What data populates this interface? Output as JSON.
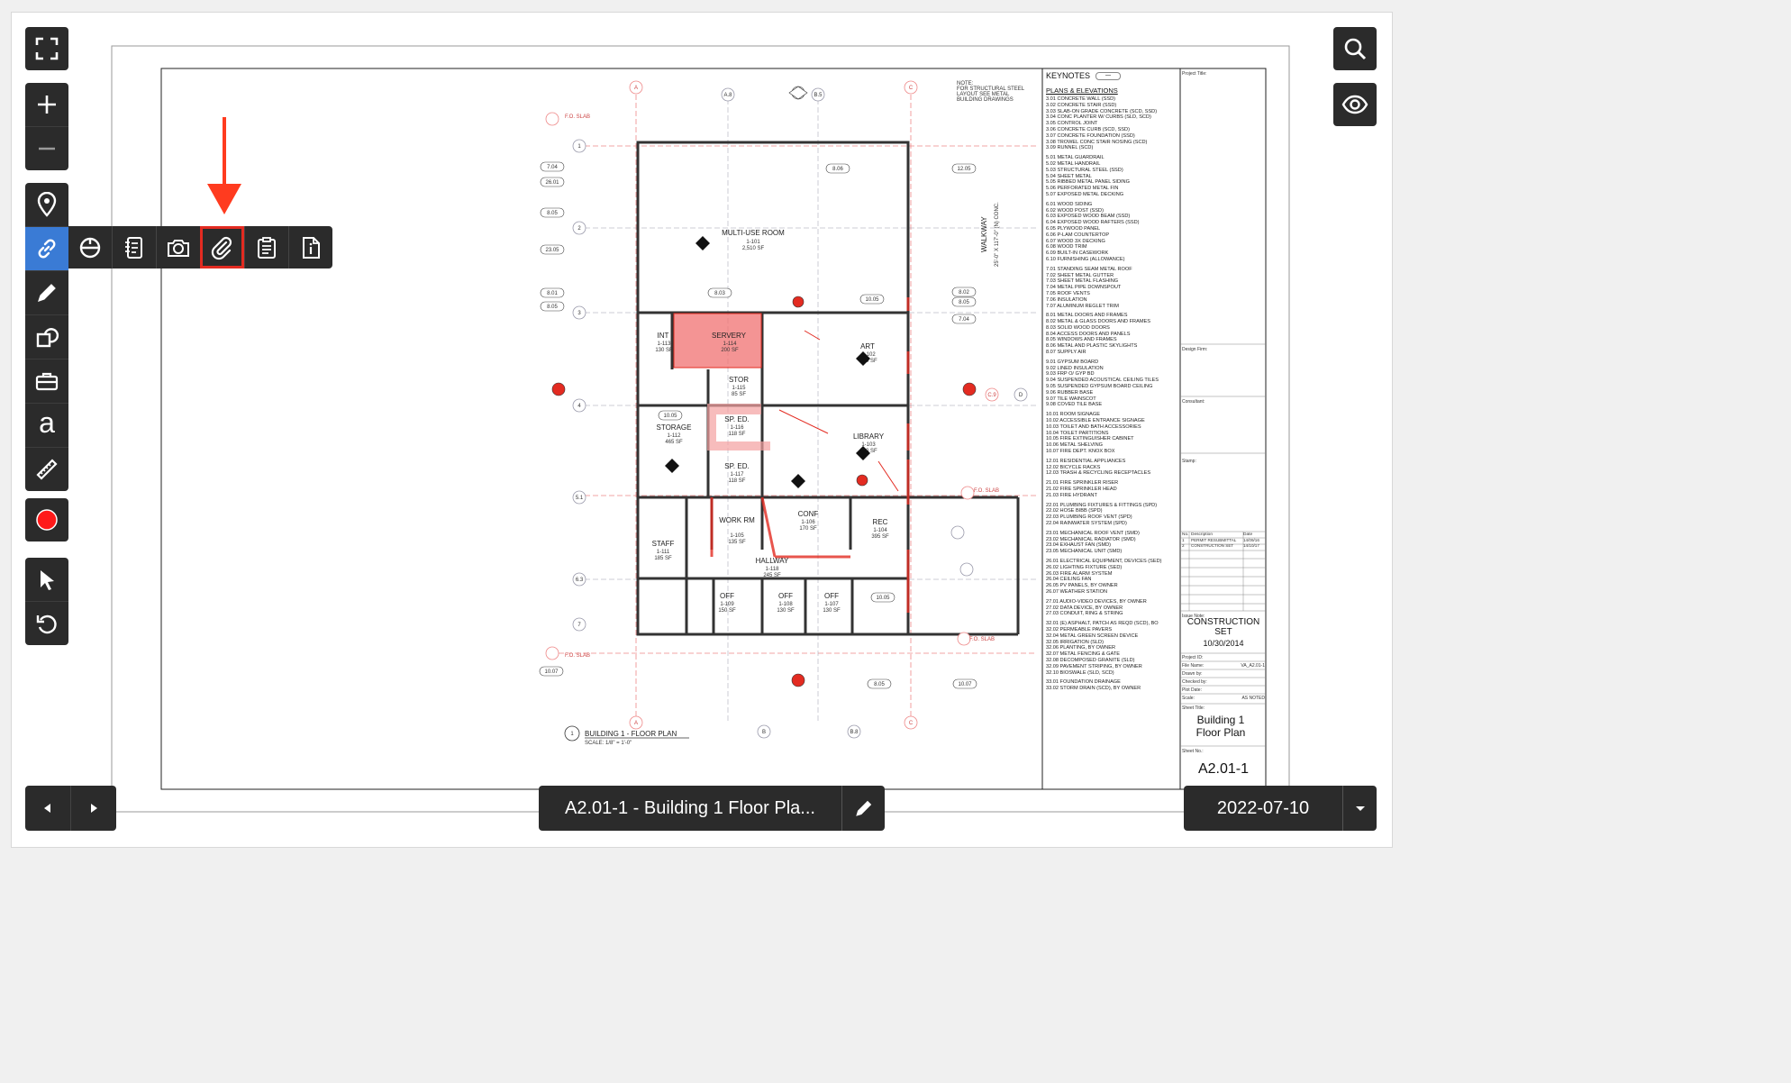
{
  "sheet": {
    "keynotes_title": "KEYNOTES",
    "keynotes_section": "PLANS & ELEVATIONS",
    "keynotes": [
      "3.01 CONCRETE WALL (SSD)",
      "3.02 CONCRETE STAIR (SSD)",
      "3.03 SLAB-ON GRADE CONCRETE (SCD, SSD)",
      "3.04 CONC PLANTER W/ CURBS (SLD, SCD)",
      "3.05 CONTROL JOINT",
      "3.06 CONCRETE CURB (SCD, SSD)",
      "3.07 CONCRETE FOUNDATION (SSD)",
      "3.08 TROWEL CONC STAIR NOSING (SCD)",
      "3.09 RUNNEL (SCD)",
      "5.01 METAL GUARDRAIL",
      "5.02 METAL HANDRAIL",
      "5.03 STRUCTURAL STEEL (SSD)",
      "5.04 SHEET METAL",
      "5.05 RIBBED METAL PANEL SIDING",
      "5.06 PERFORATED METAL FIN",
      "5.07 EXPOSED METAL DECKING",
      "6.01 WOOD SIDING",
      "6.02 WOOD POST (SSD)",
      "6.03 EXPOSED WOOD BEAM (SSD)",
      "6.04 EXPOSED WOOD RAFTERS (SSD)",
      "6.05 PLYWOOD PANEL",
      "6.06 P-LAM COUNTERTOP",
      "6.07 WOOD 3X DECKING",
      "6.08 WOOD TRIM",
      "6.09 BUILT-IN CASEWORK",
      "6.10 FURNISHING (ALLOWANCE)",
      "7.01 STANDING SEAM METAL ROOF",
      "7.02 SHEET METAL GUTTER",
      "7.03 SHEET METAL FLASHING",
      "7.04 METAL PIPE DOWNSPOUT",
      "7.05 ROOF VENTS",
      "7.06 INSULATION",
      "7.07 ALUMINUM REGLET TRIM",
      "8.01 METAL DOORS AND FRAMES",
      "8.02 METAL & GLASS DOORS AND FRAMES",
      "8.03 SOLID WOOD DOORS",
      "8.04 ACCESS DOORS AND PANELS",
      "8.05 WINDOWS AND FRAMES",
      "8.06 METAL AND PLASTIC SKYLIGHTS",
      "8.07 SUPPLY AIR",
      "9.01 GYPSUM BOARD",
      "9.02 LINED INSULATION",
      "9.03 FRP O/ GYP BD",
      "9.04 SUSPENDED ACOUSTICAL CEILING TILES",
      "9.05 SUSPENDED GYPSUM BOARD CEILING",
      "9.06 RUBBER BASE",
      "9.07 TILE WAINSCOT",
      "9.08 COVED TILE BASE",
      "10.01 ROOM SIGNAGE",
      "10.02 ACCESSIBLE ENTRANCE SIGNAGE",
      "10.03 TOILET AND BATH ACCESSORIES",
      "10.04 TOILET PARTITIONS",
      "10.05 FIRE EXTINGUISHER CABINET",
      "10.06 METAL SHELVING",
      "10.07 FIRE DEPT. KNOX BOX",
      "12.01 RESIDENTIAL APPLIANCES",
      "12.02 BICYCLE RACKS",
      "12.03 TRASH & RECYCLING RECEPTACLES",
      "21.01 FIRE SPRINKLER RISER",
      "21.02 FIRE SPRINKLER HEAD",
      "21.03 FIRE HYDRANT",
      "22.01 PLUMBING FIXTURES & FITTINGS (SPD)",
      "22.02 HOSE BIBB (SPD)",
      "22.03 PLUMBING ROOF VENT (SPD)",
      "22.04 RAINWATER SYSTEM (SPD)",
      "23.01 MECHANICAL ROOF VENT (SMD)",
      "23.02 MECHANICAL RADIATOR (SMD)",
      "23.04 EXHAUST FAN (SMD)",
      "23.05 MECHANICAL UNIT (SMD)",
      "26.01 ELECTRICAL EQUIPMENT, DEVICES (SED)",
      "26.02 LIGHTING FIXTURE (SED)",
      "26.03 FIRE ALARM SYSTEM",
      "26.04 CEILING FAN",
      "26.05 PV PANELS, BY OWNER",
      "26.07 WEATHER STATION",
      "27.01 AUDIO-VIDEO DEVICES, BY OWNER",
      "27.02 DATA DEVICE, BY OWNER",
      "27.03 CONDUIT, RING & STRING",
      "32.01 (E) ASPHALT, PATCH AS REQD (SCD), BO",
      "32.02 PERMEABLE PAVERS",
      "32.04 METAL GREEN SCREEN DEVICE",
      "32.05 IRRIGATION (SLD)",
      "32.06 PLANTING, BY OWNER",
      "32.07 METAL FENCING & GATE",
      "32.08 DECOMPOSED GRANITE (SLD)",
      "32.09 PAVEMENT STRIPING, BY OWNER",
      "32.10 BIOSWALE (SLD, SCD)",
      "33.01 FOUNDATION DRAINAGE",
      "33.02 STORM DRAIN (SCD), BY OWNER"
    ],
    "rooms": [
      {
        "name": "MULTI-USE ROOM",
        "num": "1-101",
        "area": "2,510 SF"
      },
      {
        "name": "INT",
        "num": "1-113",
        "area": "130 SF"
      },
      {
        "name": "SERVERY",
        "num": "1-114",
        "area": "200 SF"
      },
      {
        "name": "STOR",
        "num": "1-115",
        "area": "85 SF"
      },
      {
        "name": "ART",
        "num": "1-102",
        "area": "480 SF"
      },
      {
        "name": "STORAGE",
        "num": "1-112",
        "area": "465 SF"
      },
      {
        "name": "SP. ED.",
        "num": "1-116",
        "area": "118 SF"
      },
      {
        "name": "SP. ED.",
        "num": "1-117",
        "area": "118 SF"
      },
      {
        "name": "LIBRARY",
        "num": "1-103",
        "area": "830 SF"
      },
      {
        "name": "WORK RM",
        "num": "1-105",
        "area": "135 SF"
      },
      {
        "name": "CONF",
        "num": "1-106",
        "area": "170 SF"
      },
      {
        "name": "REC",
        "num": "1-104",
        "area": "395 SF"
      },
      {
        "name": "STAFF",
        "num": "1-111",
        "area": "185 SF"
      },
      {
        "name": "HALLWAY",
        "num": "1-118",
        "area": "245 SF"
      },
      {
        "name": "OFF",
        "num": "1-109",
        "area": "150 SF"
      },
      {
        "name": "OFF",
        "num": "1-108",
        "area": "130 SF"
      },
      {
        "name": "OFF",
        "num": "1-107",
        "area": "130 SF"
      }
    ],
    "walkway_label": "WALKWAY",
    "walkway_dim": "25'-0\" X 117'-0\" (N) CONC.",
    "plan_title": "BUILDING 1 - FLOOR PLAN",
    "plan_scale": "SCALE: 1/8\" = 1'-0\"",
    "plan_ref": "A2.01-1",
    "note_text": "NOTE: FOR STRUCTURAL STEEL LAYOUT SEE METAL BUILDING DRAWINGS",
    "fo_slab": "F.O. SLAB",
    "project_title_label": "Project Title:",
    "design_firm_label": "Design Firm:",
    "consultant_label": "Consultant:",
    "stamp_label": "Stamp:",
    "rev_headers": [
      "No.",
      "Description",
      "Date"
    ],
    "revisions": [
      {
        "no": "1",
        "desc": "PERMIT RESUBMITTAL",
        "date": "14/09/16"
      },
      {
        "no": "2",
        "desc": "CONSTRUCTION SET",
        "date": "14/10/17"
      }
    ],
    "issue_note_label": "Issue Note:",
    "issue_status": "CONSTRUCTION SET",
    "issue_date": "10/30/2014",
    "project_id_label": "Project ID:",
    "file_name_label": "File Name:",
    "file_name": "VA_A2.01-1",
    "drawn_by_label": "Drawn by:",
    "checked_by_label": "Checked by:",
    "plot_date_label": "Plot Date:",
    "scale_label": "Scale:",
    "scale_value": "AS NOTED",
    "sheet_title_label": "Sheet Title:",
    "sheet_title": "Building 1 Floor Plan",
    "sheet_no_label": "Sheet No.:",
    "sheet_no": "A2.01-1"
  },
  "toolbar": {
    "left_icons": [
      "fullscreen-icon",
      "zoom-in-icon",
      "zoom-out-icon",
      "location-pin-icon",
      "link-icon",
      "pencil-icon",
      "shapes-icon",
      "toolbox-icon",
      "text-icon",
      "ruler-icon",
      "record-icon",
      "pointer-icon",
      "undo-icon"
    ],
    "link_submenu": [
      "hyperlink-sheet-icon",
      "rfi-icon",
      "photo-icon",
      "attachment-icon",
      "punch-list-icon",
      "document-icon"
    ],
    "text_glyph": "a"
  },
  "right_toolbar": [
    "search-icon",
    "eye-icon"
  ],
  "bottom": {
    "drawing_title": "A2.01-1 - Building 1 Floor Pla...",
    "date": "2022-07-10"
  },
  "colors": {
    "toolbar_bg": "#2b2b2b",
    "active_blue": "#3a7bd5",
    "markup_red": "#e32b21",
    "record_red": "#ff1a1a"
  }
}
